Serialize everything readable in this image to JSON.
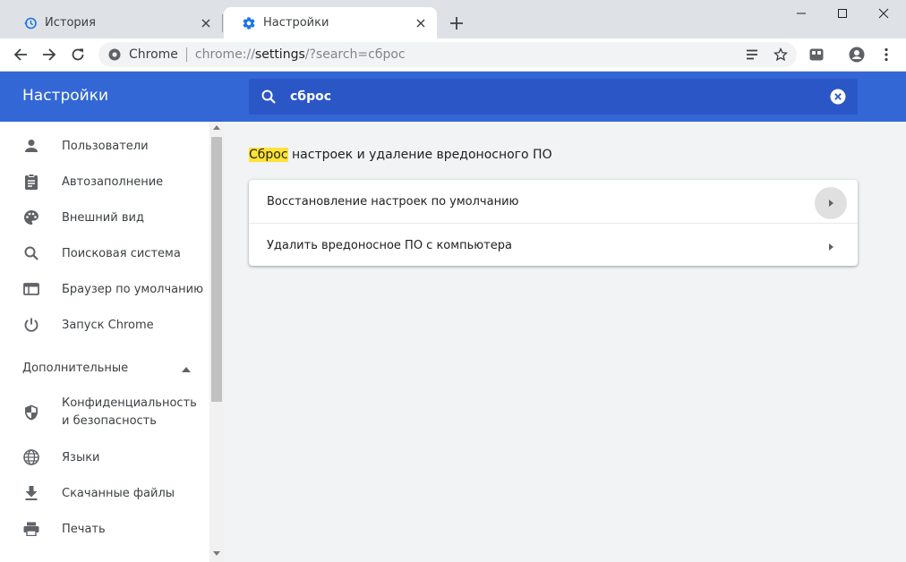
{
  "tabs": [
    {
      "title": "История",
      "icon": "history-icon"
    },
    {
      "title": "Настройки",
      "icon": "gear-icon"
    }
  ],
  "omnibox": {
    "site_label": "Chrome",
    "url_scheme": "chrome://",
    "url_host": "settings",
    "url_rest": "/?search=сброс"
  },
  "header": {
    "title": "Настройки",
    "search_value": "сброс"
  },
  "sidebar": {
    "items": [
      {
        "label": "Пользователи",
        "icon": "person-icon"
      },
      {
        "label": "Автозаполнение",
        "icon": "clipboard-icon"
      },
      {
        "label": "Внешний вид",
        "icon": "palette-icon"
      },
      {
        "label": "Поисковая система",
        "icon": "search-icon"
      },
      {
        "label": "Браузер по умолчанию",
        "icon": "browser-window-icon"
      },
      {
        "label": "Запуск Chrome",
        "icon": "power-icon"
      }
    ],
    "advanced_label": "Дополнительные",
    "advanced_items": [
      {
        "label": "Конфиденциальность и безопасность",
        "icon": "shield-icon"
      },
      {
        "label": "Языки",
        "icon": "globe-icon"
      },
      {
        "label": "Скачанные файлы",
        "icon": "download-icon"
      },
      {
        "label": "Печать",
        "icon": "printer-icon"
      }
    ]
  },
  "main": {
    "section_title_highlight": "Сброс",
    "section_title_rest": " настроек и удаление вредоносного ПО",
    "rows": [
      {
        "label": "Восстановление настроек по умолчанию"
      },
      {
        "label": "Удалить вредоносное ПО с компьютера"
      }
    ]
  },
  "colors": {
    "header_blue": "#3367d6",
    "search_blue": "#2a56c6",
    "highlight": "#ffe234",
    "tab_active_icon": "#1a73e8"
  }
}
